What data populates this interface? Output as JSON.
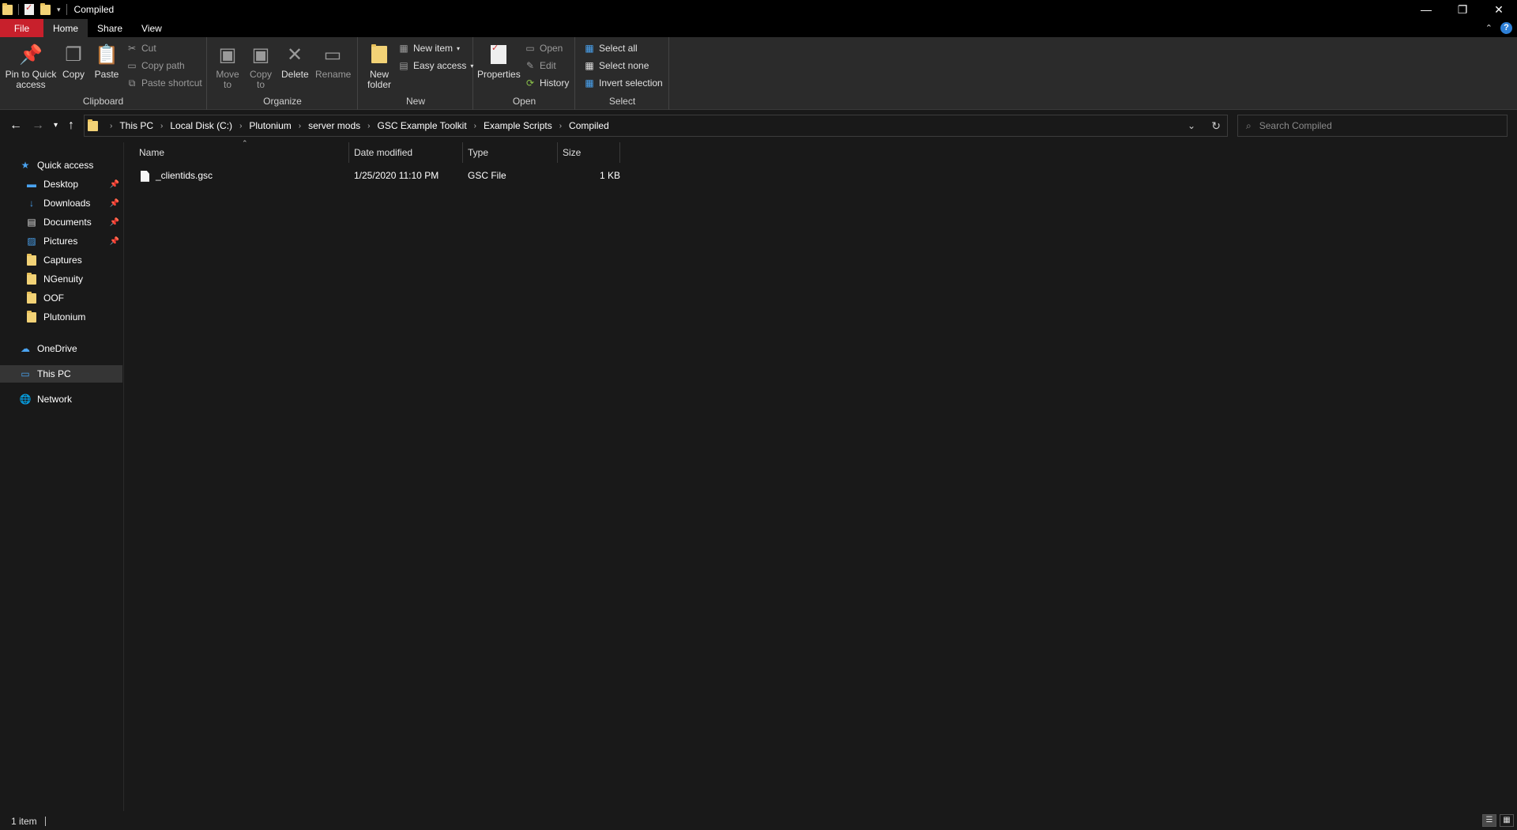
{
  "window": {
    "title": "Compiled"
  },
  "tabs": {
    "file": "File",
    "home": "Home",
    "share": "Share",
    "view": "View"
  },
  "ribbon": {
    "clipboard": {
      "label": "Clipboard",
      "pin": "Pin to Quick access",
      "copy": "Copy",
      "paste": "Paste",
      "cut": "Cut",
      "copy_path": "Copy path",
      "paste_shortcut": "Paste shortcut"
    },
    "organize": {
      "label": "Organize",
      "move_to": "Move to",
      "copy_to": "Copy to",
      "delete": "Delete",
      "rename": "Rename"
    },
    "new": {
      "label": "New",
      "new_folder": "New folder",
      "new_item": "New item",
      "easy_access": "Easy access"
    },
    "open": {
      "label": "Open",
      "properties": "Properties",
      "open": "Open",
      "edit": "Edit",
      "history": "History"
    },
    "select": {
      "label": "Select",
      "select_all": "Select all",
      "select_none": "Select none",
      "invert": "Invert selection"
    }
  },
  "breadcrumb": [
    "This PC",
    "Local Disk (C:)",
    "Plutonium",
    "server mods",
    "GSC Example Toolkit",
    "Example Scripts",
    "Compiled"
  ],
  "search": {
    "placeholder": "Search Compiled"
  },
  "nav": {
    "quick_access": "Quick access",
    "pinned": [
      "Desktop",
      "Downloads",
      "Documents",
      "Pictures"
    ],
    "folders": [
      "Captures",
      "NGenuity",
      "OOF",
      "Plutonium"
    ],
    "onedrive": "OneDrive",
    "this_pc": "This PC",
    "network": "Network"
  },
  "columns": {
    "name": "Name",
    "date": "Date modified",
    "type": "Type",
    "size": "Size"
  },
  "files": [
    {
      "name": "_clientids.gsc",
      "date": "1/25/2020 11:10 PM",
      "type": "GSC File",
      "size": "1 KB"
    }
  ],
  "status": {
    "count": "1 item"
  },
  "colors": {
    "file_tab": "#c8202c",
    "folder": "#f2d276",
    "accent": "#2d7fd6"
  }
}
